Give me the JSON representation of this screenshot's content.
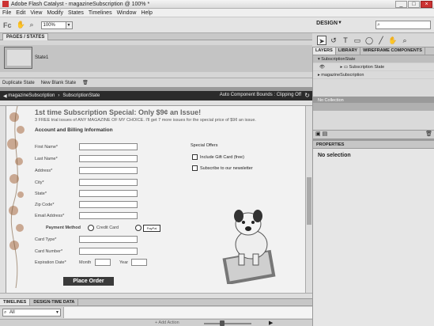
{
  "window": {
    "title": "Adobe Flash Catalyst - magazineSubscription @ 100% *",
    "controls": [
      "_",
      "□",
      "×"
    ]
  },
  "menu": [
    "File",
    "Edit",
    "View",
    "Modify",
    "States",
    "Timelines",
    "Window",
    "Help"
  ],
  "toolbar": {
    "logo": "Fc",
    "zoom": "100%",
    "workspace": "DESIGN"
  },
  "pages_panel": {
    "tab": "PAGES / STATES",
    "state_name": "State1",
    "duplicate_btn": "Duplicate State",
    "new_blank_btn": "New Blank State"
  },
  "canvas": {
    "breadcrumb_root": "magazineSubscription",
    "breadcrumb_state": "SubscriptionState",
    "right_label": "Auto Component Bounds : Clipping Off"
  },
  "form": {
    "headline": "1st time Subscription Special: Only $9¢ an Issue!",
    "subline": "3 FREE trial issues of ANY MAGAZINE OF MY CHOICE. I'll get 7 more issues for the special price of $9¢ an issue.",
    "section_title": "Account and Billing Information",
    "fields": [
      {
        "label": "First Name*"
      },
      {
        "label": "Last Name*"
      },
      {
        "label": "Address*"
      },
      {
        "label": "City*"
      },
      {
        "label": "State*"
      },
      {
        "label": "Zip Code*"
      },
      {
        "label": "Email Address*"
      }
    ],
    "payment_label": "Payment Method",
    "credit_card": "Credit Card",
    "paypal": "PayPal",
    "card_type": "Card Type*",
    "card_number": "Card Number*",
    "expiration": "Expiration Date*",
    "month": "Month",
    "year": "Year",
    "special_offers": "Special Offers",
    "offer1": "Include Gift Card (free)",
    "offer2": "Subscribe to our newsletter",
    "place_order": "Place Order"
  },
  "layers": {
    "tabs": [
      "LAYERS",
      "LIBRARY",
      "WIREFRAME COMPONENTS"
    ],
    "rows": [
      "SubscriptionState",
      "Subscription State",
      "magazineSubscription"
    ],
    "no_collection": "No Collection"
  },
  "properties": {
    "tab": "PROPERTIES",
    "no_selection": "No selection"
  },
  "timelines": {
    "tabs": [
      "TIMELINES",
      "DESIGN-TIME DATA"
    ],
    "select_value": "All",
    "add_action": "+ Add Action"
  }
}
